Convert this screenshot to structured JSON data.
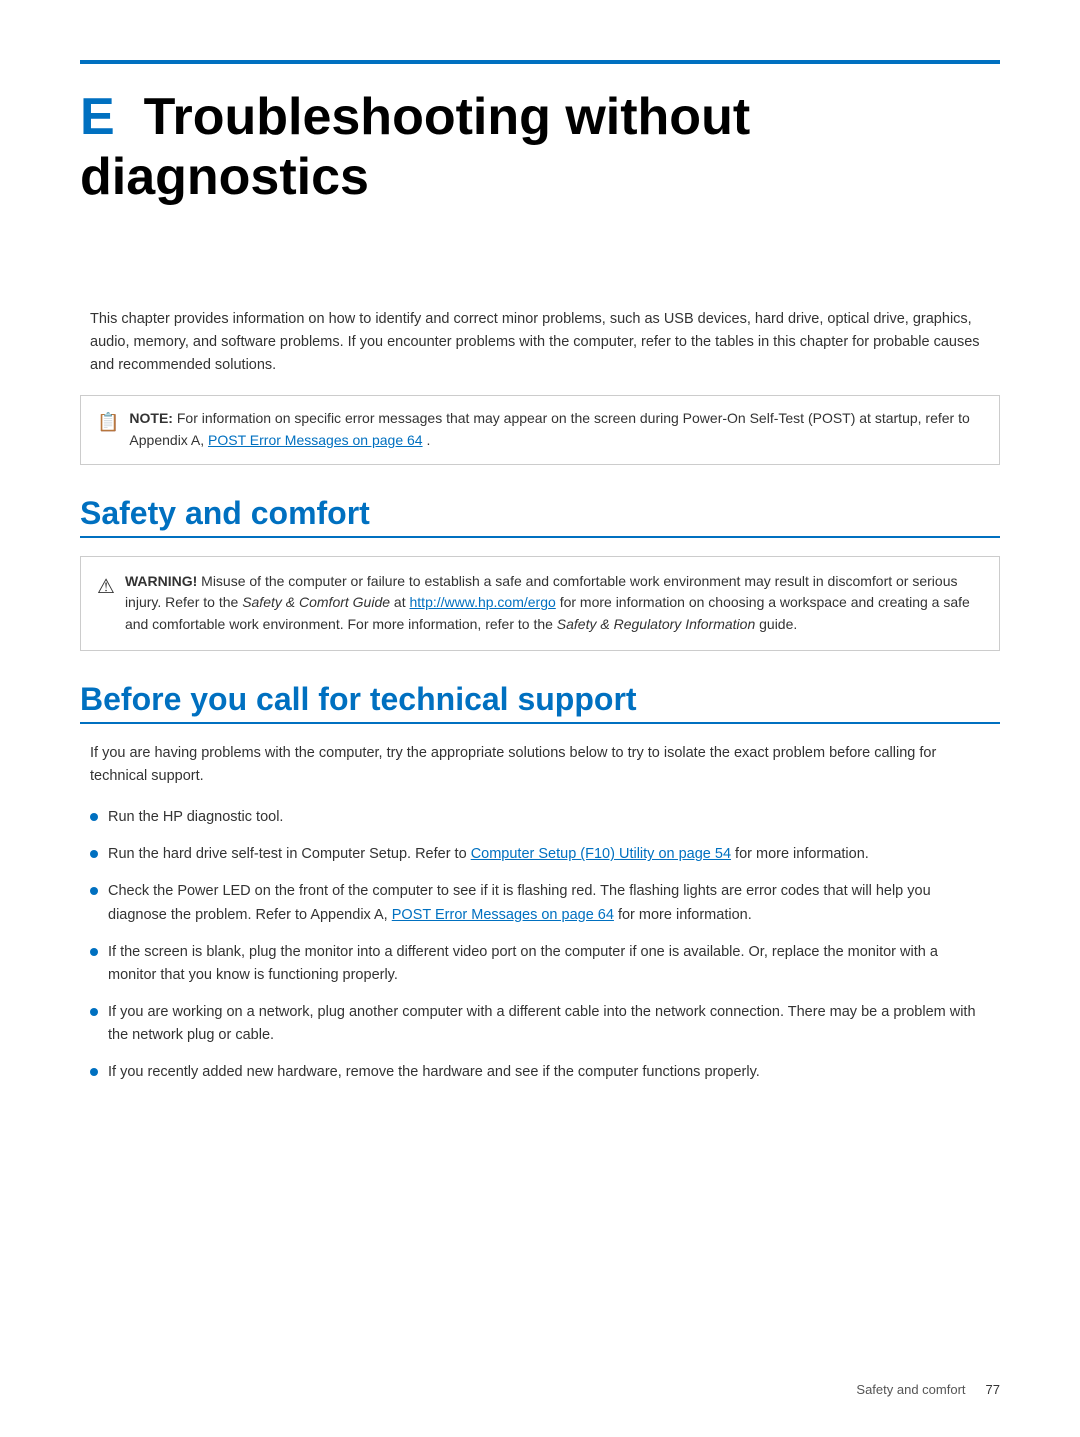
{
  "page": {
    "top_border_color": "#0070c0",
    "chapter_letter": "E",
    "chapter_title": "Troubleshooting without diagnostics",
    "intro_paragraph": "This chapter provides information on how to identify and correct minor problems, such as USB devices, hard drive, optical drive, graphics, audio, memory, and software problems. If you encounter problems with the computer, refer to the tables in this chapter for probable causes and recommended solutions.",
    "note": {
      "label": "NOTE:",
      "text": "For information on specific error messages that may appear on the screen during Power-On Self-Test (POST) at startup, refer to Appendix A, ",
      "link_text": "POST Error Messages on page 64",
      "link_end": "."
    },
    "section1": {
      "title": "Safety and comfort",
      "warning": {
        "label": "WARNING!",
        "text_before": "Misuse of the computer or failure to establish a safe and comfortable work environment may result in discomfort or serious injury. Refer to the ",
        "italic1": "Safety & Comfort Guide",
        "text_middle": " at ",
        "link1_text": "http://www.hp.com/ergo",
        "text_after": " for more information on choosing a workspace and creating a safe and comfortable work environment. For more information, refer to the ",
        "italic2": "Safety & Regulatory Information",
        "text_end": " guide."
      }
    },
    "section2": {
      "title": "Before you call for technical support",
      "intro": "If you are having problems with the computer, try the appropriate solutions below to try to isolate the exact problem before calling for technical support.",
      "bullets": [
        {
          "text": "Run the HP diagnostic tool.",
          "link_text": "",
          "link_url": ""
        },
        {
          "text_before": "Run the hard drive self-test in Computer Setup. Refer to ",
          "link_text": "Computer Setup (F10) Utility on page 54",
          "text_after": " for more information.",
          "has_link": true
        },
        {
          "text": "Check the Power LED on the front of the computer to see if it is flashing red. The flashing lights are error codes that will help you diagnose the problem. Refer to Appendix A, ",
          "link_text": "POST Error Messages on page 64",
          "text_after": " for more information.",
          "has_link": true
        },
        {
          "text": "If the screen is blank, plug the monitor into a different video port on the computer if one is available. Or, replace the monitor with a monitor that you know is functioning properly.",
          "has_link": false
        },
        {
          "text": "If you are working on a network, plug another computer with a different cable into the network connection. There may be a problem with the network plug or cable.",
          "has_link": false
        },
        {
          "text": "If you recently added new hardware, remove the hardware and see if the computer functions properly.",
          "has_link": false
        }
      ]
    },
    "footer": {
      "section_label": "Safety and comfort",
      "page_number": "77"
    }
  }
}
